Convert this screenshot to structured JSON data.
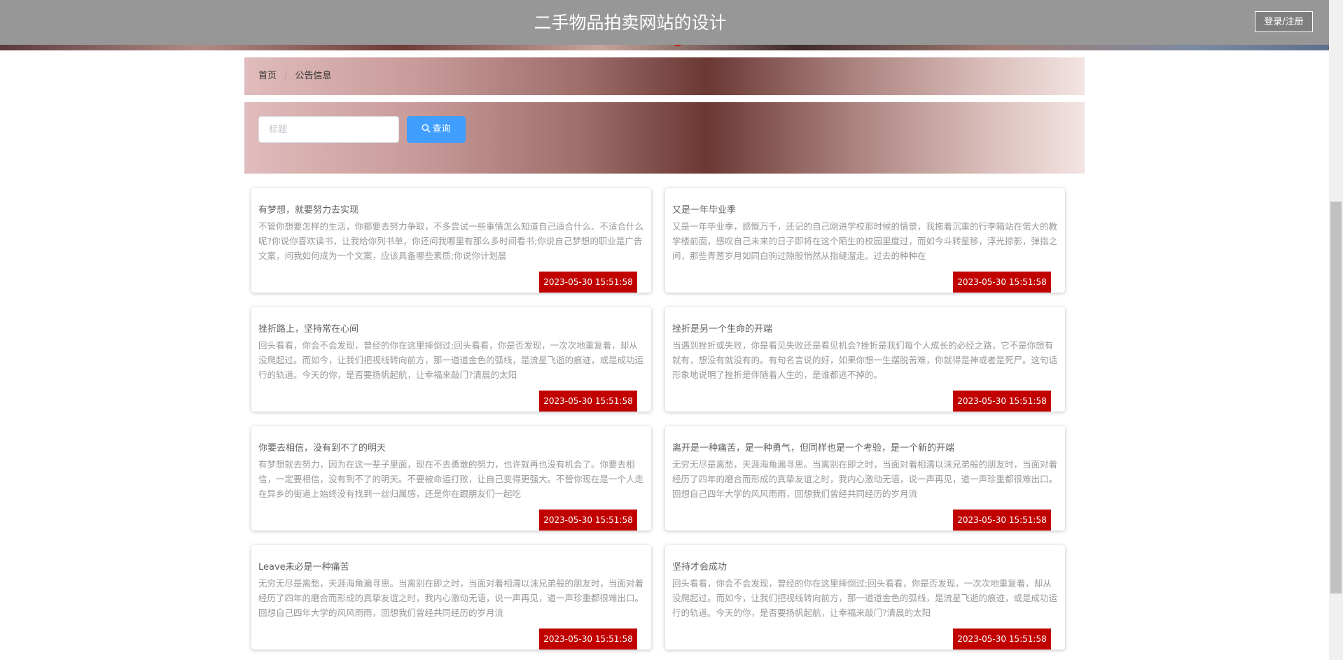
{
  "header": {
    "title": "二手物品拍卖网站的设计",
    "login_label": "登录/注册"
  },
  "breadcrumb": {
    "home": "首页",
    "separator": "/",
    "current": "公告信息"
  },
  "search": {
    "placeholder": "标题",
    "button_label": "查询"
  },
  "colors": {
    "date_badge": "#c10000",
    "search_button": "#409eff",
    "header": "#979797"
  },
  "cards": [
    {
      "title": "有梦想，就要努力去实现",
      "body": "不管你想要怎样的生活，你都要去努力争取，不多尝试一些事情怎么知道自己适合什么、不适合什么呢?你说你喜欢读书，让我给你列书单，你还问我哪里有那么多时间看书;你说自己梦想的职业是广告文案，问我如何成为一个文案，应该具备哪些素质;你说你计划晨",
      "date": "2023-05-30 15:51:58"
    },
    {
      "title": "又是一年毕业季",
      "body": "又是一年毕业季，感慨万千，还记的自己刚进学校那时候的情景，我拖着沉重的行李箱站在偌大的教学楼前面，感叹自己未来的日子即将在这个陌生的校园里度过，而如今斗转星移，浮光掠影，弹指之间，那些青葱岁月如同白驹过隙般悄然从指缝溜走。过去的种种在",
      "date": "2023-05-30 15:51:58"
    },
    {
      "title": "挫折路上，坚持常在心间",
      "body": "回头看看，你会不会发现，曾经的你在这里摔倒过;回头看看，你是否发现，一次次地重复着，却从没爬起过。而如今，让我们把视线转向前方，那一道道金色的弧线，是流星飞逝的痕迹，或是成功运行的轨道。今天的你，是否要扬帆起航，让幸福来敲门?清晨的太阳",
      "date": "2023-05-30 15:51:58"
    },
    {
      "title": "挫折是另一个生命的开端",
      "body": "当遇到挫折或失败，你是看见失败还是看见机会?挫折是我们每个人成长的必经之路，它不是你想有就有，想没有就没有的。有句名言说的好，如果你想一生摆脱苦难，你就得是神或者是死尸。这句话形象地说明了挫折是伴随着人生的，是谁都逃不掉的。",
      "date": "2023-05-30 15:51:58"
    },
    {
      "title": "你要去相信，没有到不了的明天",
      "body": "有梦想就去努力，因为在这一辈子里面，现在不去勇敢的努力，也许就再也没有机会了。你要去相信，一定要相信，没有到不了的明天。不要被命运打败，让自己变得更强大。不管你现在是一个人走在异乡的街道上始终没有找到一丝归属感，还是你在跟朋友们一起吃",
      "date": "2023-05-30 15:51:58"
    },
    {
      "title": "离开是一种痛苦，是一种勇气，但同样也是一个考验，是一个新的开端",
      "body": "无穷无尽是离愁，天涯海角遍寻思。当离别在即之时，当面对着相濡以沫兄弟般的朋友时，当面对着经历了四年的磨合而形成的真挚友谊之时，我内心激动无语，说一声再见，道一声珍重都很难出口。回想自己四年大学的风风雨雨，回想我们曾经共同经历的岁月流",
      "date": "2023-05-30 15:51:58"
    },
    {
      "title": "Leave未必是一种痛苦",
      "body": "无穷无尽是离愁，天涯海角遍寻思。当离别在即之时，当面对着相濡以沫兄弟般的朋友时，当面对着经历了四年的磨合而形成的真挚友谊之时，我内心激动无语，说一声再见，道一声珍重都很难出口。回想自己四年大学的风风雨雨，回想我们曾经共同经历的岁月流",
      "date": "2023-05-30 15:51:58"
    },
    {
      "title": "坚持才会成功",
      "body": "回头看看，你会不会发现，曾经的你在这里摔倒过;回头看看，你是否发现，一次次地重复着，却从没爬起过。而如今，让我们把视线转向前方，那一道道金色的弧线，是流星飞逝的痕迹，或是成功运行的轨道。今天的你，是否要扬帆起航，让幸福来敲门?清晨的太阳",
      "date": "2023-05-30 15:51:58"
    }
  ]
}
